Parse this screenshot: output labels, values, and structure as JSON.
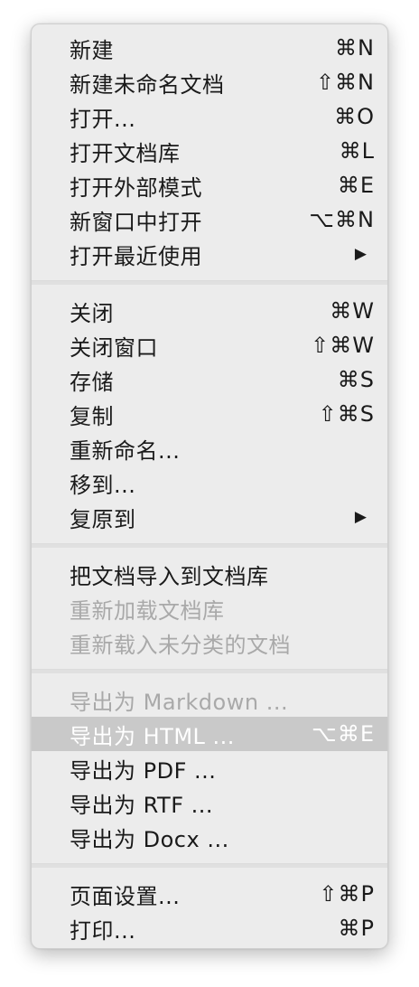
{
  "menu": {
    "groups": [
      [
        {
          "label": "新建",
          "shortcut": "⌘N",
          "enabled": true
        },
        {
          "label": "新建未命名文档",
          "shortcut": "⇧⌘N",
          "enabled": true
        },
        {
          "label": "打开...",
          "shortcut": "⌘O",
          "enabled": true
        },
        {
          "label": "打开文档库",
          "shortcut": "⌘L",
          "enabled": true
        },
        {
          "label": "打开外部模式",
          "shortcut": "⌘E",
          "enabled": true
        },
        {
          "label": "新窗口中打开",
          "shortcut": "⌥⌘N",
          "enabled": true
        },
        {
          "label": "打开最近使用",
          "shortcut": "▶",
          "submenu": true,
          "enabled": true
        }
      ],
      [
        {
          "label": "关闭",
          "shortcut": "⌘W",
          "enabled": true
        },
        {
          "label": "关闭窗口",
          "shortcut": "⇧⌘W",
          "enabled": true
        },
        {
          "label": "存储",
          "shortcut": "⌘S",
          "enabled": true
        },
        {
          "label": "复制",
          "shortcut": "⇧⌘S",
          "enabled": true
        },
        {
          "label": "重新命名...",
          "shortcut": "",
          "enabled": true
        },
        {
          "label": "移到...",
          "shortcut": "",
          "enabled": true
        },
        {
          "label": "复原到",
          "shortcut": "▶",
          "submenu": true,
          "enabled": true
        }
      ],
      [
        {
          "label": "把文档导入到文档库",
          "shortcut": "",
          "enabled": true
        },
        {
          "label": "重新加载文档库",
          "shortcut": "",
          "enabled": false
        },
        {
          "label": "重新载入未分类的文档",
          "shortcut": "",
          "enabled": false
        }
      ],
      [
        {
          "label": "导出为 Markdown ...",
          "shortcut": "",
          "enabled": false
        },
        {
          "label": "导出为 HTML ...",
          "shortcut": "⌥⌘E",
          "enabled": true,
          "highlighted": true
        },
        {
          "label": "导出为 PDF ...",
          "shortcut": "",
          "enabled": true
        },
        {
          "label": "导出为 RTF ...",
          "shortcut": "",
          "enabled": true
        },
        {
          "label": "导出为 Docx ...",
          "shortcut": "",
          "enabled": true
        }
      ],
      [
        {
          "label": "页面设置...",
          "shortcut": "⇧⌘P",
          "enabled": true
        },
        {
          "label": "打印...",
          "shortcut": "⌘P",
          "enabled": true
        }
      ]
    ]
  }
}
